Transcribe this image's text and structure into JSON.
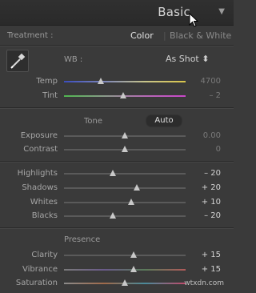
{
  "panel": {
    "title": "Basic"
  },
  "treatment": {
    "label": "Treatment :",
    "options": [
      "Color",
      "Black & White"
    ],
    "selected": "Color"
  },
  "wb": {
    "label": "WB :",
    "value": "As Shot",
    "icon": "eyedropper-icon"
  },
  "temp": {
    "label": "Temp",
    "value": "4700",
    "position": 0.3
  },
  "tint": {
    "label": "Tint",
    "value": "– 2",
    "position": 0.49
  },
  "tone": {
    "title": "Tone",
    "auto_label": "Auto"
  },
  "exposure": {
    "label": "Exposure",
    "value": "0.00",
    "position": 0.5
  },
  "contrast": {
    "label": "Contrast",
    "value": "0",
    "position": 0.5
  },
  "highlights": {
    "label": "Highlights",
    "value": "– 20",
    "position": 0.4
  },
  "shadows": {
    "label": "Shadows",
    "value": "+ 20",
    "position": 0.6
  },
  "whites": {
    "label": "Whites",
    "value": "+ 10",
    "position": 0.55
  },
  "blacks": {
    "label": "Blacks",
    "value": "– 20",
    "position": 0.4
  },
  "presence": {
    "title": "Presence"
  },
  "clarity": {
    "label": "Clarity",
    "value": "+ 15",
    "position": 0.575
  },
  "vibrance": {
    "label": "Vibrance",
    "value": "+ 15",
    "position": 0.575
  },
  "saturation": {
    "label": "Saturation",
    "value": "",
    "position": 0.5
  },
  "watermark": "wtxdn.com",
  "colors": {
    "background": "#3a3a3a",
    "header": "#2c2c2c",
    "text": "#b8b8b8"
  }
}
